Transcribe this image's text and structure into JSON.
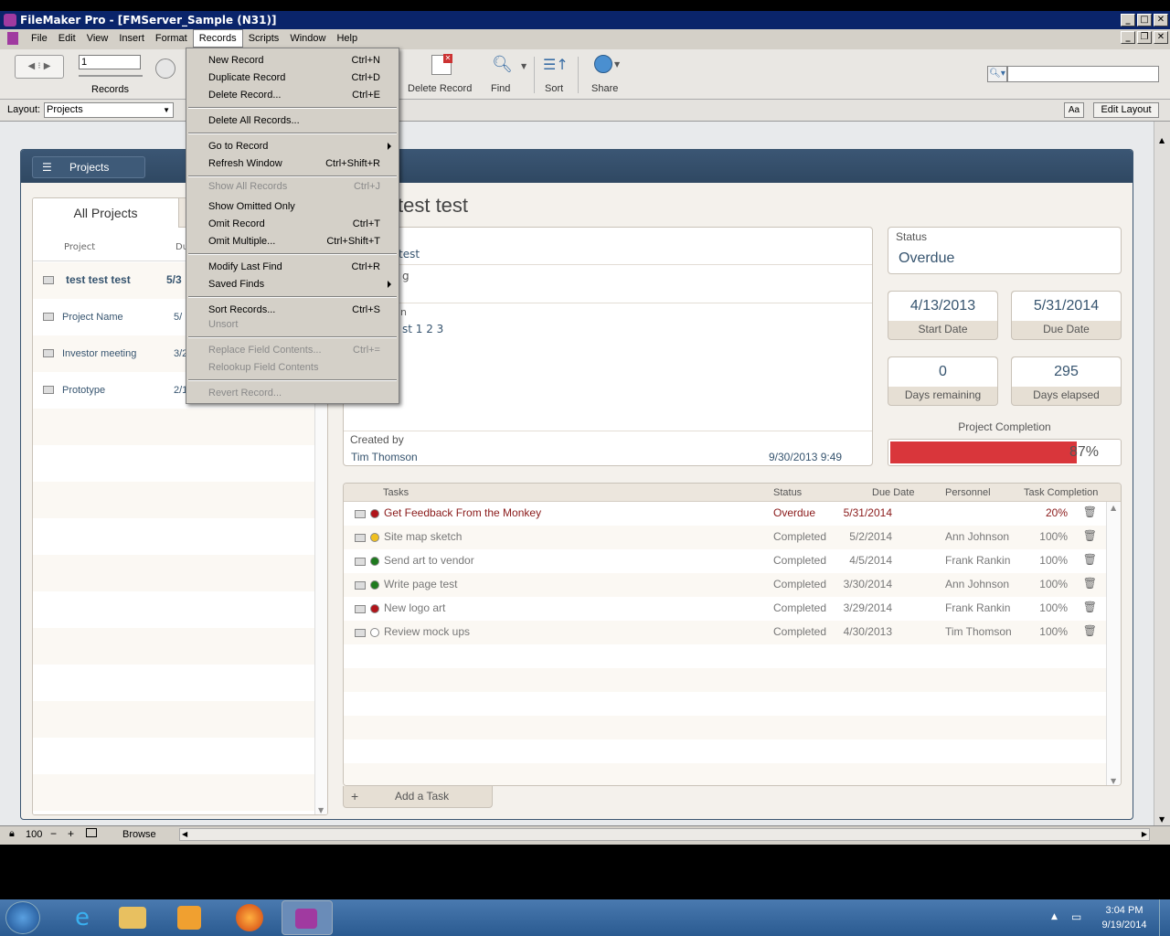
{
  "window": {
    "title": "FileMaker Pro - [FMServer_Sample (N31)]"
  },
  "menubar": {
    "items": [
      "File",
      "Edit",
      "View",
      "Insert",
      "Format",
      "Records",
      "Scripts",
      "Window",
      "Help"
    ],
    "active": "Records"
  },
  "toolbar": {
    "record_number": "1",
    "records_label": "Records",
    "delete_record_label": "Delete Record",
    "find_label": "Find",
    "sort_label": "Sort",
    "share_label": "Share",
    "search_placeholder": ""
  },
  "layoutbar": {
    "layout_label": "Layout:",
    "layout_value": "Projects",
    "aa_label": "Aa",
    "edit_layout_label": "Edit Layout"
  },
  "records_menu": {
    "items": [
      {
        "label": "New Record",
        "shortcut": "Ctrl+N"
      },
      {
        "label": "Duplicate Record",
        "shortcut": "Ctrl+D"
      },
      {
        "label": "Delete Record...",
        "shortcut": "Ctrl+E"
      },
      {
        "label": "Delete All Records...",
        "shortcut": ""
      },
      {
        "label": "Go to Record",
        "shortcut": ""
      },
      {
        "label": "Refresh Window",
        "shortcut": "Ctrl+Shift+R"
      },
      {
        "label": "Show All Records",
        "shortcut": "Ctrl+J"
      },
      {
        "label": "Show Omitted Only",
        "shortcut": ""
      },
      {
        "label": "Omit Record",
        "shortcut": "Ctrl+T"
      },
      {
        "label": "Omit Multiple...",
        "shortcut": "Ctrl+Shift+T"
      },
      {
        "label": "Modify Last Find",
        "shortcut": "Ctrl+R"
      },
      {
        "label": "Saved Finds",
        "shortcut": ""
      },
      {
        "label": "Sort Records...",
        "shortcut": "Ctrl+S"
      },
      {
        "label": "Unsort",
        "shortcut": ""
      },
      {
        "label": "Replace Field Contents...",
        "shortcut": "Ctrl+="
      },
      {
        "label": "Relookup Field Contents",
        "shortcut": ""
      },
      {
        "label": "Revert Record...",
        "shortcut": ""
      }
    ]
  },
  "sidebar": {
    "header_label": "Projects",
    "tab_label": "All Projects",
    "col_project": "Project",
    "col_due": "Du",
    "projects": [
      {
        "name": "test test test",
        "due": "5/3"
      },
      {
        "name": "Project Name",
        "due": "5/"
      },
      {
        "name": "Investor meeting",
        "due": "3/2"
      },
      {
        "name": "Prototype",
        "due": "2/1"
      }
    ]
  },
  "detail": {
    "title_fragment": "test test",
    "field1_fragment": "test",
    "field2_fragment": "g",
    "field3_label_fragment": "n",
    "field3_value_fragment": "st 1 2 3",
    "created_by_label": "Created by",
    "created_by_value": "Tim Thomson",
    "created_ts": "9/30/2013 9:49",
    "status_label": "Status",
    "status_value": "Overdue",
    "start_date_value": "4/13/2013",
    "start_date_label": "Start Date",
    "due_date_value": "5/31/2014",
    "due_date_label": "Due Date",
    "days_remaining_value": "0",
    "days_remaining_label": "Days remaining",
    "days_elapsed_value": "295",
    "days_elapsed_label": "Days elapsed",
    "completion_label": "Project Completion",
    "completion_text": "87%",
    "completion_fraction": 0.81,
    "completion_color": "#d9363b"
  },
  "tasks": {
    "headers": {
      "task": "Tasks",
      "status": "Status",
      "due": "Due Date",
      "personnel": "Personnel",
      "completion": "Task Completion"
    },
    "rows": [
      {
        "name": "Get Feedback From the Monkey",
        "status": "Overdue",
        "due": "5/31/2014",
        "personnel": "",
        "completion": "20%",
        "dot": "#b0141a"
      },
      {
        "name": "Site map sketch",
        "status": "Completed",
        "due": "5/2/2014",
        "personnel": "Ann Johnson",
        "completion": "100%",
        "dot": "#f0c020"
      },
      {
        "name": "Send art to vendor",
        "status": "Completed",
        "due": "4/5/2014",
        "personnel": "Frank Rankin",
        "completion": "100%",
        "dot": "#1f7a1f"
      },
      {
        "name": "Write page test",
        "status": "Completed",
        "due": "3/30/2014",
        "personnel": "Ann Johnson",
        "completion": "100%",
        "dot": "#1f7a1f"
      },
      {
        "name": "New logo art",
        "status": "Completed",
        "due": "3/29/2014",
        "personnel": "Frank Rankin",
        "completion": "100%",
        "dot": "#b0141a"
      },
      {
        "name": "Review mock ups",
        "status": "Completed",
        "due": "4/30/2013",
        "personnel": "Tim Thomson",
        "completion": "100%",
        "dot": "#ffffff"
      }
    ],
    "add_task_label": "Add a Task"
  },
  "statusbar": {
    "zoom": "100",
    "mode": "Browse"
  },
  "taskbar": {
    "time": "3:04 PM",
    "date": "9/19/2014"
  }
}
